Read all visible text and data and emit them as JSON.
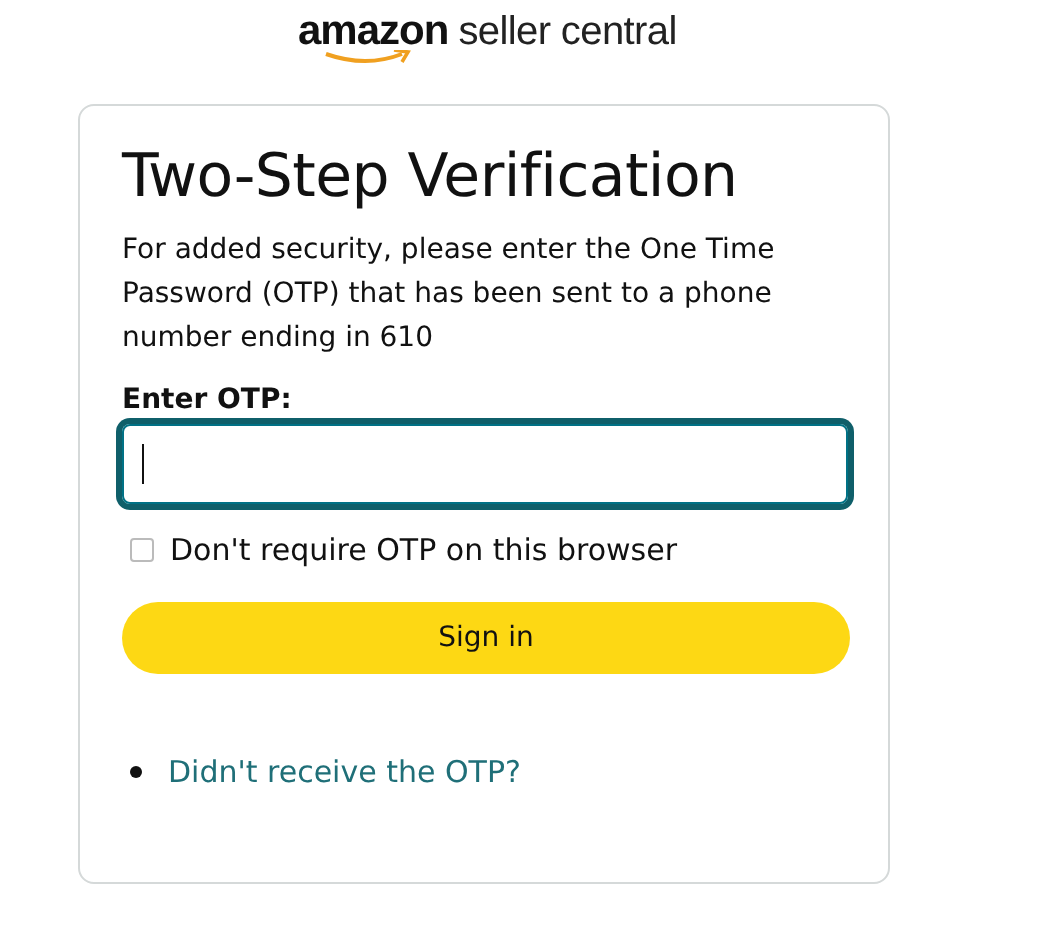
{
  "logo": {
    "brand": "amazon",
    "product": "seller central"
  },
  "card": {
    "title": "Two-Step Verification",
    "message": "For added security, please enter the One Time Password (OTP) that has been sent to a phone number ending in 610",
    "otp_field": {
      "label": "Enter OTP:",
      "focused": true
    },
    "remember": {
      "label": "Don't require OTP on this browser",
      "checked": false
    },
    "button": "Sign in",
    "links": [
      "Didn't receive the OTP?"
    ]
  }
}
